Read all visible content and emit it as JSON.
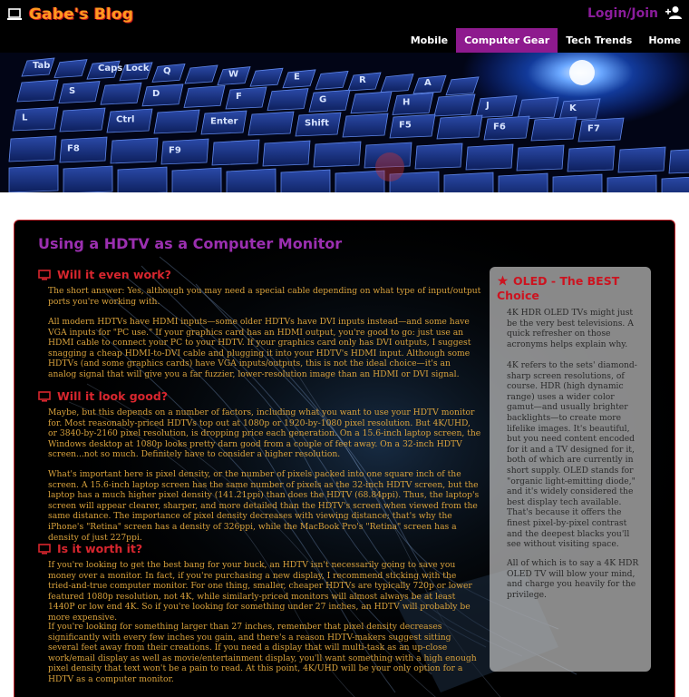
{
  "header": {
    "brand": "Gabe's Blog",
    "login_label": "Login/Join",
    "icons": {
      "brand": "laptop-icon",
      "user": "add-user-icon"
    },
    "colors": {
      "brand": "#ff9a1f",
      "brand_outline": "#c4161c",
      "login": "#8a1c9a",
      "nav_active": "#8e1a8e"
    }
  },
  "nav": {
    "items": [
      {
        "label": "Mobile",
        "active": false
      },
      {
        "label": "Computer Gear",
        "active": true
      },
      {
        "label": "Tech Trends",
        "active": false
      },
      {
        "label": "Home",
        "active": false
      }
    ]
  },
  "banner": {
    "keys": [
      "Tab",
      "Caps Lock",
      "Q",
      "W",
      "E",
      "R",
      "A",
      "S",
      "D",
      "F",
      "G",
      "H",
      "J",
      "K",
      "L",
      "Ctrl",
      "Enter",
      "Shift",
      "F5",
      "F6",
      "F7",
      "F8",
      "F9"
    ]
  },
  "article": {
    "title": "Using a HDTV as a Computer Monitor",
    "colors": {
      "title": "#9b2fb0",
      "heading": "#d8262e",
      "body": "#d9a23c"
    },
    "sections": [
      {
        "heading": "Will it even work?",
        "paragraphs": [
          "The short answer: Yes, although you may need a special cable depending on what type of input/output ports you're working with.",
          "All modern HDTVs have HDMI inputs—some older HDTVs have DVI inputs instead—and some have VGA inputs for \"PC use.\" If your graphics card has an HDMI output, you're good to go: just use an HDMI cable to connect your PC to your HDTV. If your graphics card only has DVI outputs, I suggest snagging a cheap HDMI-to-DVI cable and plugging it into your HDTV's HDMI input. Although some HDTVs (and some graphics cards) have VGA inputs/outputs, this is not the ideal choice—it's an analog signal that will give you a far fuzzier, lower-resolution image than an HDMI or DVI signal."
        ]
      },
      {
        "heading": "Will it look good?",
        "paragraphs": [
          "Maybe, but this depends on a number of factors, including what you want to use your HDTV monitor for. Most reasonably-priced HDTVs top out at 1080p or 1920-by-1080 pixel resolution. But 4K/UHD, or 3840-by-2160 pixel resolution, is dropping price each generation. On a 15.6-inch laptop screen, the Windows desktop at 1080p looks pretty darn good from a couple of feet away. On a 32-inch HDTV screen...not so much. Definitely have to consider a higher resolution.",
          "What's important here is pixel density, or the number of pixels packed into one square inch of the screen. A 15.6-inch laptop screen has the same number of pixels as the 32-inch HDTV screen, but the laptop has a much higher pixel density (141.21ppi) than does the HDTV (68.84ppi). Thus, the laptop's screen will appear clearer, sharper, and more detailed than the HDTV's screen when viewed from the same distance. The importance of pixel density decreases with viewing distance; that's why the iPhone's \"Retina\" screen has a density of 326ppi, while the MacBook Pro's \"Retina\" screen has a density of just 227ppi."
        ]
      },
      {
        "heading": "Is it worth it?",
        "paragraphs": [
          "If you're looking to get the best bang for your buck, an HDTV isn't necessarily going to save you money over a monitor. In fact, if you're purchasing a new display, I recommend sticking with the tried-and-true computer monitor. For one thing, smaller, cheaper HDTVs are typically 720p or lower featured 1080p resolution, not 4K, while similarly-priced monitors will almost always be at least 1440P or low end 4K. So if you're looking for something under 27 inches, an HDTV will probably be more expensive.",
          "If you're looking for something larger than 27 inches, remember that pixel density decreases significantly with every few inches you gain, and there's a reason HDTV-makers suggest sitting several feet away from their creations. If you need a display that will multi-task as an up-close work/email display as well as movie/entertainment display, you'll want something with a high enough pixel density that text won't be a pain to read. At this point, 4K/UHD will be your only option for a HDTV as a computer monitor."
        ]
      }
    ]
  },
  "sidebar": {
    "heading": "OLED - The BEST Choice",
    "icon": "star-icon",
    "paragraphs": [
      "4K HDR OLED TVs might just be the very best televisions. A quick refresher on those acronyms helps explain why.",
      "4K refers to the sets' diamond-sharp screen resolutions, of course. HDR (high dynamic range) uses a wider color gamut—and usually brighter backlights—to create more lifelike images. It's beautiful, but you need content encoded for it and a TV designed for it, both of which are currently in short supply. OLED stands for \"organic light-emitting diode,\" and it's widely considered the best display tech available. That's because it offers the finest pixel-by-pixel contrast and the deepest blacks you'll see without visiting space.",
      "All of which is to say a 4K HDR OLED TV will blow your mind, and charge you heavily for the privilege."
    ]
  }
}
